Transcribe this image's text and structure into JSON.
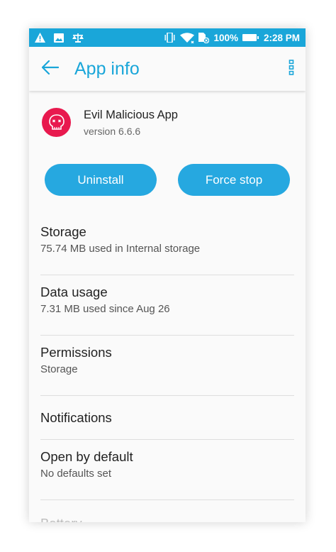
{
  "status_bar": {
    "battery_percent": "100%",
    "time": "2:28 PM"
  },
  "app_bar": {
    "title": "App info"
  },
  "app": {
    "name": "Evil Malicious App",
    "version": "version 6.6.6"
  },
  "actions": {
    "uninstall": "Uninstall",
    "force_stop": "Force stop"
  },
  "settings": {
    "storage": {
      "title": "Storage",
      "subtitle": "75.74 MB used in Internal storage"
    },
    "data_usage": {
      "title": "Data usage",
      "subtitle": "7.31 MB used since Aug 26"
    },
    "permissions": {
      "title": "Permissions",
      "subtitle": "Storage"
    },
    "notifications": {
      "title": "Notifications"
    },
    "open_by_default": {
      "title": "Open by default",
      "subtitle": "No defaults set"
    },
    "battery": {
      "title": "Battery"
    }
  },
  "colors": {
    "accent": "#1aa6d9",
    "button": "#26a8e0",
    "app_icon": "#e8194e"
  },
  "icons": [
    "warning-icon",
    "image-icon",
    "scale-icon",
    "vibrate-icon",
    "wifi-icon",
    "sim-icon",
    "battery-icon",
    "back-arrow-icon",
    "more-vert-icon",
    "skull-icon"
  ]
}
